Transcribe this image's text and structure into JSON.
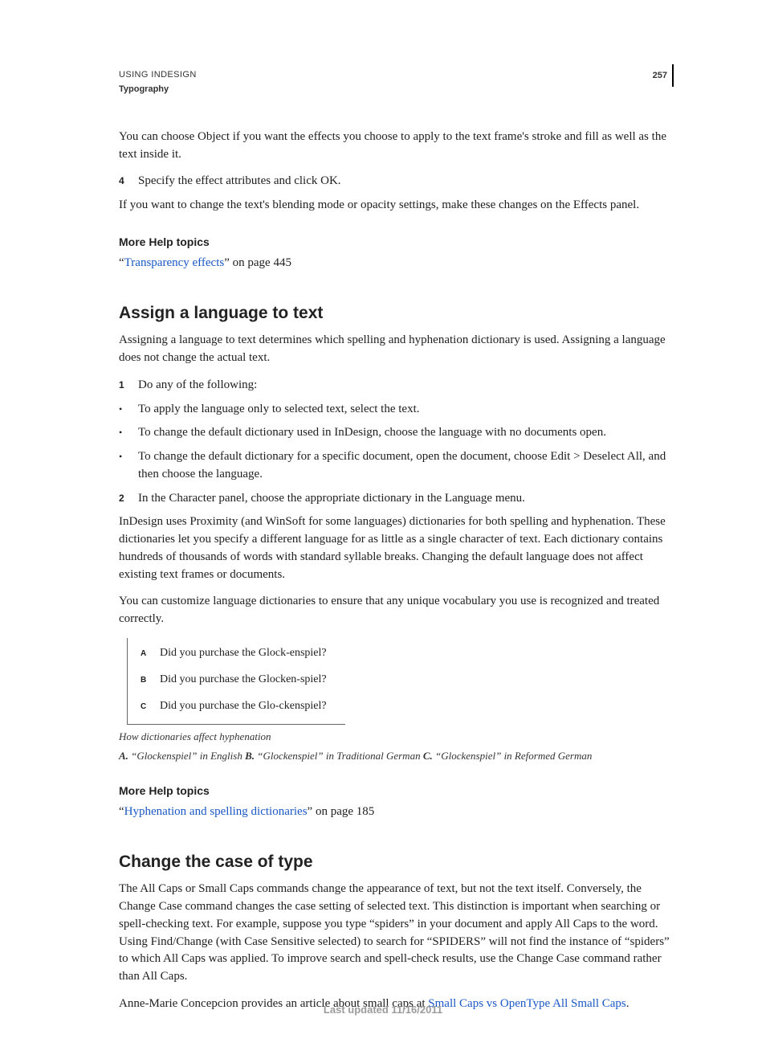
{
  "header": {
    "doc_title": "USING INDESIGN",
    "chapter": "Typography",
    "page_number": "257"
  },
  "sec_prev": {
    "p1": "You can choose Object if you want the effects you choose to apply to the text frame's stroke and fill as well as the text inside it.",
    "step4_num": "4",
    "step4_text": "Specify the effect attributes and click OK.",
    "p2": "If you want to change the text's blending mode or opacity settings, make these changes on the Effects panel."
  },
  "help1": {
    "heading": "More Help topics",
    "link_quote_open": "“",
    "link_text": "Transparency effects",
    "link_quote_close": "”",
    "link_suffix": " on page 445"
  },
  "sec_lang": {
    "heading": "Assign a language to text",
    "intro": "Assigning a language to text determines which spelling and hyphenation dictionary is used. Assigning a language does not change the actual text.",
    "step1_num": "1",
    "step1_text": "Do any of the following:",
    "bul1": "To apply the language only to selected text, select the text.",
    "bul2": "To change the default dictionary used in InDesign, choose the language with no documents open.",
    "bul3": "To change the default dictionary for a specific document, open the document, choose Edit > Deselect All, and then choose the language.",
    "step2_num": "2",
    "step2_text": "In the Character panel, choose the appropriate dictionary in the Language menu.",
    "p_after1": "InDesign uses Proximity (and WinSoft for some languages) dictionaries for both spelling and hyphenation. These dictionaries let you specify a different language for as little as a single character of text. Each dictionary contains hundreds of thousands of words with standard syllable breaks. Changing the default language does not affect existing text frames or documents.",
    "p_after2": "You can customize language dictionaries to ensure that any unique vocabulary you use is recognized and treated correctly."
  },
  "figure": {
    "rows": [
      {
        "tag": "A",
        "text": "Did you purchase the Glock-enspiel?"
      },
      {
        "tag": "B",
        "text": "Did you purchase the Glocken-spiel?"
      },
      {
        "tag": "C",
        "text": "Did you purchase the Glo-ckenspiel?"
      }
    ],
    "caption_title": "How dictionaries affect hyphenation",
    "caption_a_tag": "A.",
    "caption_a_text": " “Glockenspiel” in English  ",
    "caption_b_tag": "B.",
    "caption_b_text": " “Glockenspiel” in Traditional German  ",
    "caption_c_tag": "C.",
    "caption_c_text": " “Glockenspiel” in Reformed German"
  },
  "help2": {
    "heading": "More Help topics",
    "link_quote_open": "“",
    "link_text": "Hyphenation and spelling dictionaries",
    "link_quote_close": "”",
    "link_suffix": " on page 185"
  },
  "sec_case": {
    "heading": "Change the case of type",
    "p1": "The All Caps or Small Caps commands change the appearance of text, but not the text itself. Conversely, the Change Case command changes the case setting of selected text. This distinction is important when searching or spell-checking text. For example, suppose you type “spiders” in your document and apply All Caps to the word. Using Find/Change (with Case Sensitive selected) to search for “SPIDERS” will not find the instance of “spiders” to which All Caps was applied. To improve search and spell-check results, use the Change Case command rather than All Caps.",
    "p2_pre": "Anne-Marie Concepcion provides an article about small caps at ",
    "p2_link": "Small Caps vs OpenType All Small Caps",
    "p2_post": "."
  },
  "footer": "Last updated 11/16/2011"
}
